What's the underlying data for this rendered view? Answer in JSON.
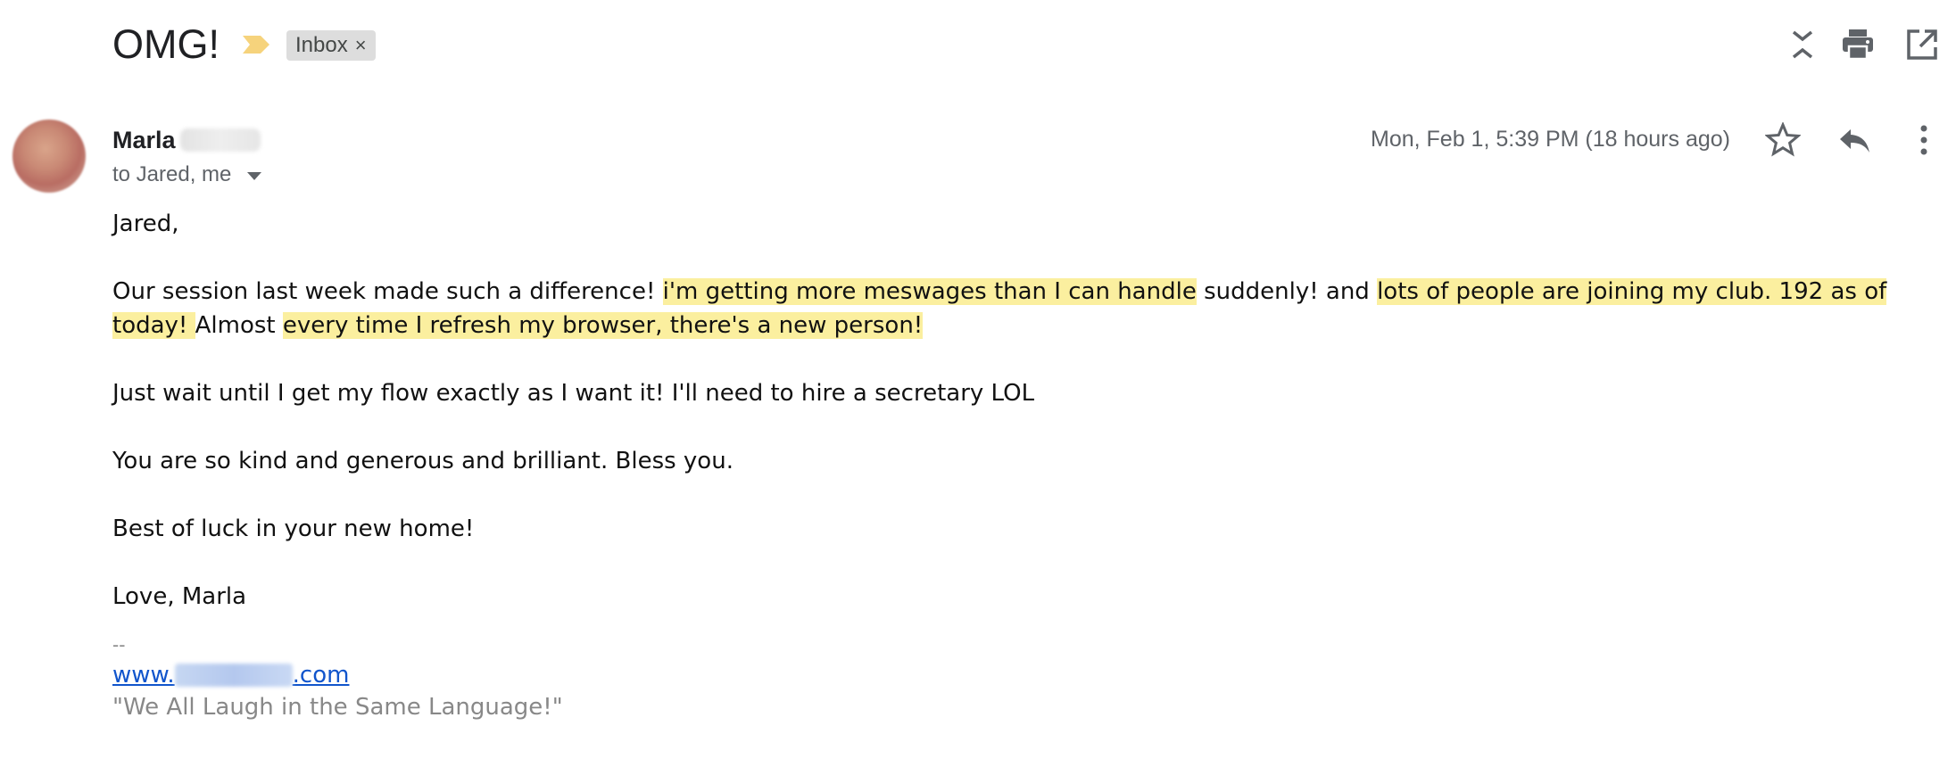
{
  "email": {
    "subject": "OMG!",
    "label": "Inbox",
    "label_remove_glyph": "×",
    "sender_name": "Marla",
    "recipients": "to Jared, me",
    "date": "Mon, Feb 1, 5:39 PM (18 hours ago)",
    "body": {
      "greeting": "Jared,",
      "p1_a": "Our session last week made such a difference! ",
      "p1_hl1": " i'm getting more meswages than I can handle",
      "p1_b": " suddenly!  and ",
      "p1_hl2": "lots of people are joining my club.  192 as of today! ",
      "p1_c": " Almost ",
      "p1_hl3": "every time I refresh my browser, there's a new person! ",
      "p2": "Just wait until I get my flow exactly as I want it!  I'll need to hire a secretary LOL",
      "p3": "You are so kind and generous and brilliant.  Bless you.",
      "p4": "Best of luck in your new home!",
      "p5": "Love, Marla"
    },
    "signature": {
      "dash": "--",
      "link_prefix": "www.",
      "link_suffix": ".com",
      "tagline": "\"We All Laugh in the Same Language!\""
    }
  },
  "icons": {
    "collapse": "collapse-all-icon",
    "print": "print-icon",
    "open_new_window": "open-in-new-window-icon",
    "star": "star-icon",
    "reply": "reply-icon",
    "more": "more-vertical-icon",
    "importance": "importance-marker-icon"
  },
  "colors": {
    "highlight": "#fbef9f",
    "importance": "#f6d37c",
    "link": "#1155cc",
    "chip_bg": "#dddddd",
    "muted_text": "#5f6368"
  }
}
